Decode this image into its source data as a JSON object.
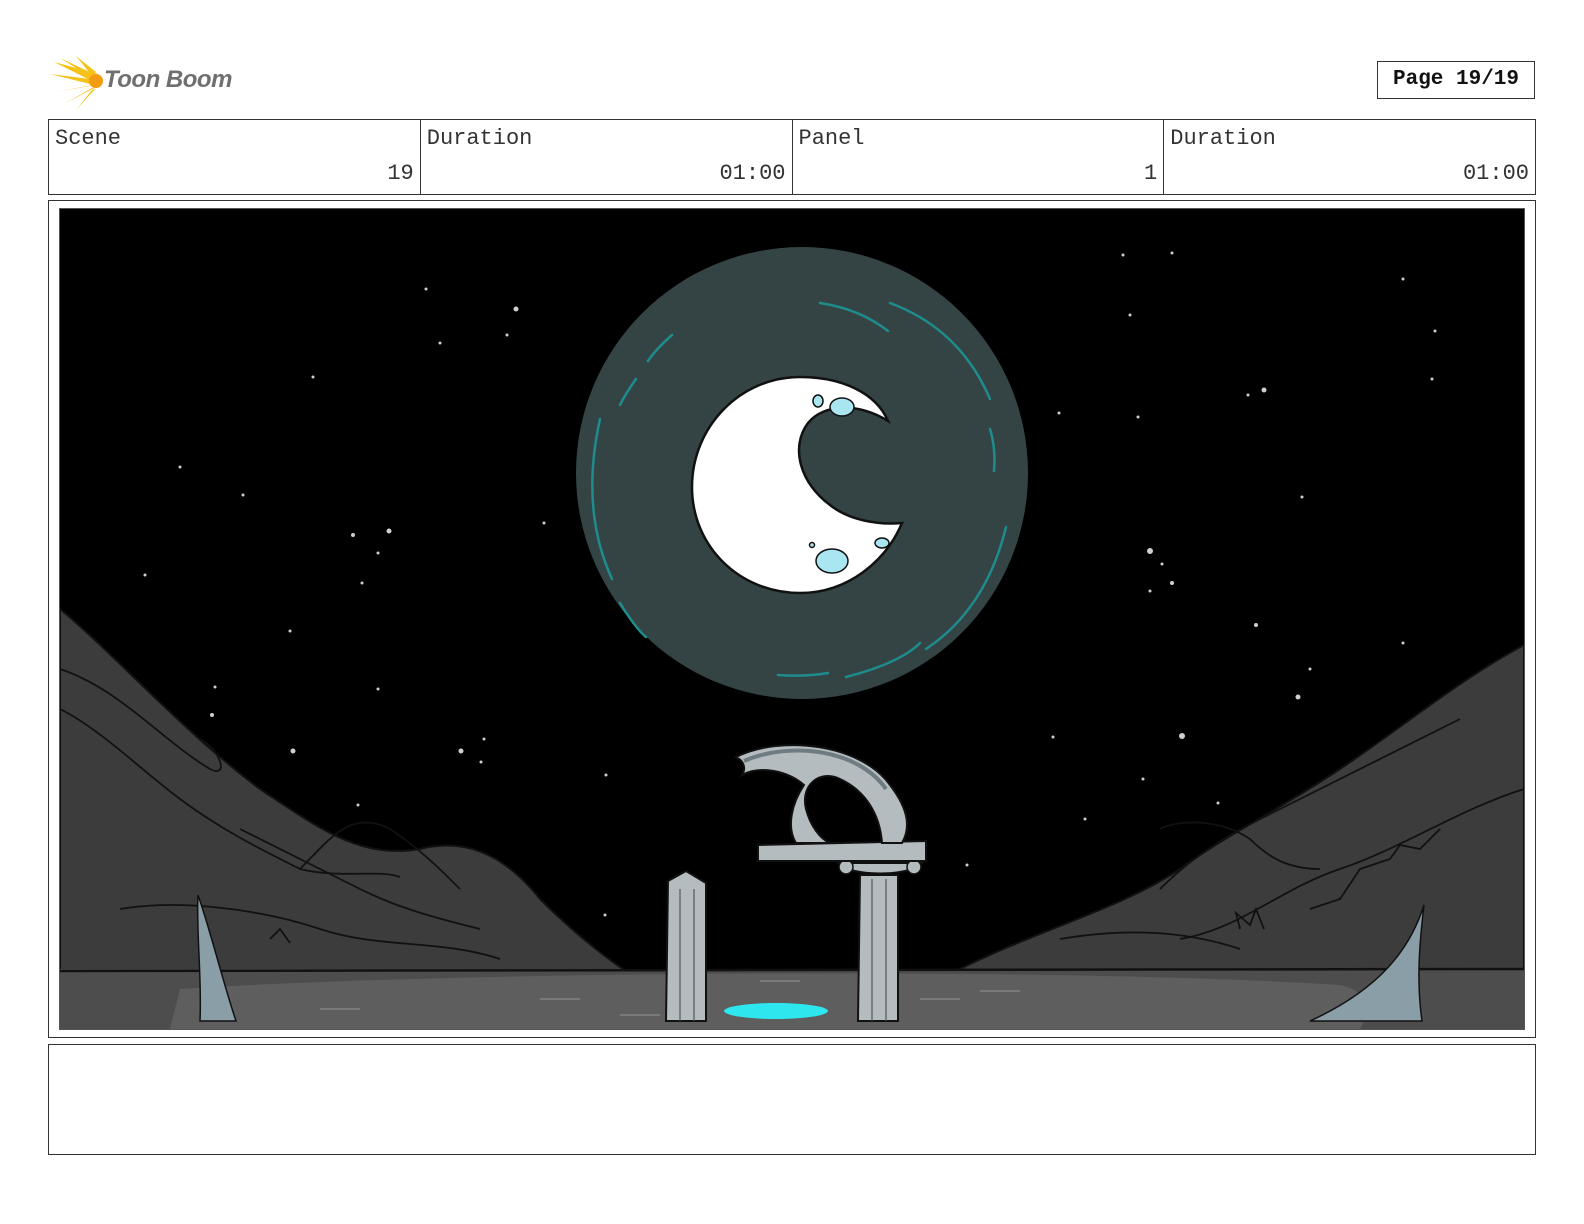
{
  "header": {
    "logo_text": "Toon Boom",
    "page_label": "Page 19/19"
  },
  "meta": {
    "scene_label": "Scene",
    "scene_value": "19",
    "duration_label": "Duration",
    "duration_value": "01:00",
    "panel_label": "Panel",
    "panel_value": "1",
    "panel_duration_label": "Duration",
    "panel_duration_value": "01:00"
  },
  "panel": {
    "illustration": "crescent-moon-night-ruins",
    "caption": ""
  },
  "colors": {
    "sky": "#000000",
    "moon_disc": "#344445",
    "moon_rim": "#1e8c8c",
    "crescent": "#ffffff",
    "crater": "#a9e6f2",
    "mountains": "#3a3a3a",
    "ground": "#5e5e5e",
    "stone": "#b5bcc0",
    "water": "#2ee6ee",
    "logo_yellow": "#f5c21a"
  }
}
